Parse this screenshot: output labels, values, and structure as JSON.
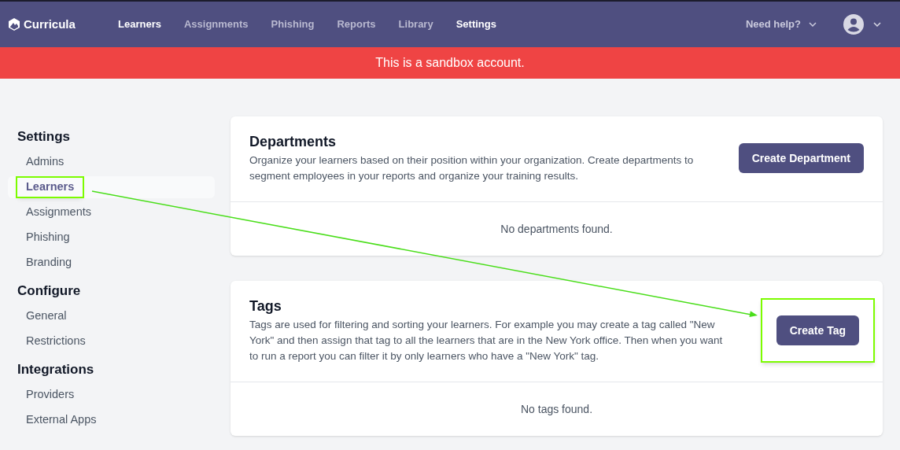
{
  "brand": {
    "name": "Curricula"
  },
  "nav": [
    {
      "label": "Learners",
      "selected": true
    },
    {
      "label": "Assignments",
      "selected": false
    },
    {
      "label": "Phishing",
      "selected": false
    },
    {
      "label": "Reports",
      "selected": false
    },
    {
      "label": "Library",
      "selected": false
    },
    {
      "label": "Settings",
      "selected": true
    }
  ],
  "help": {
    "label": "Need help?"
  },
  "banner": {
    "text": "This is a sandbox account."
  },
  "sidebar": [
    {
      "heading": "Settings",
      "items": [
        {
          "label": "Admins",
          "selected": false,
          "highlighted": false
        },
        {
          "label": "Learners",
          "selected": true,
          "highlighted": true
        },
        {
          "label": "Assignments",
          "selected": false,
          "highlighted": false
        },
        {
          "label": "Phishing",
          "selected": false,
          "highlighted": false
        },
        {
          "label": "Branding",
          "selected": false,
          "highlighted": false
        }
      ]
    },
    {
      "heading": "Configure",
      "items": [
        {
          "label": "General",
          "selected": false,
          "highlighted": false
        },
        {
          "label": "Restrictions",
          "selected": false,
          "highlighted": false
        }
      ]
    },
    {
      "heading": "Integrations",
      "items": [
        {
          "label": "Providers",
          "selected": false,
          "highlighted": false
        },
        {
          "label": "External Apps",
          "selected": false,
          "highlighted": false
        }
      ]
    }
  ],
  "cards": [
    {
      "title": "Departments",
      "description": "Organize your learners based on their position within your organization. Create departments to segment employees in your reports and organize your training results.",
      "button": {
        "label": "Create Department",
        "highlighted": false
      },
      "empty": "No departments found."
    },
    {
      "title": "Tags",
      "description": "Tags are used for filtering and sorting your learners. For example you may create a tag called \"New York\" and then assign that tag to all the learners that are in the New York office. Then when you want to run a report you can filter it by only learners who have a \"New York\" tag.",
      "button": {
        "label": "Create Tag",
        "highlighted": true
      },
      "empty": "No tags found."
    }
  ]
}
